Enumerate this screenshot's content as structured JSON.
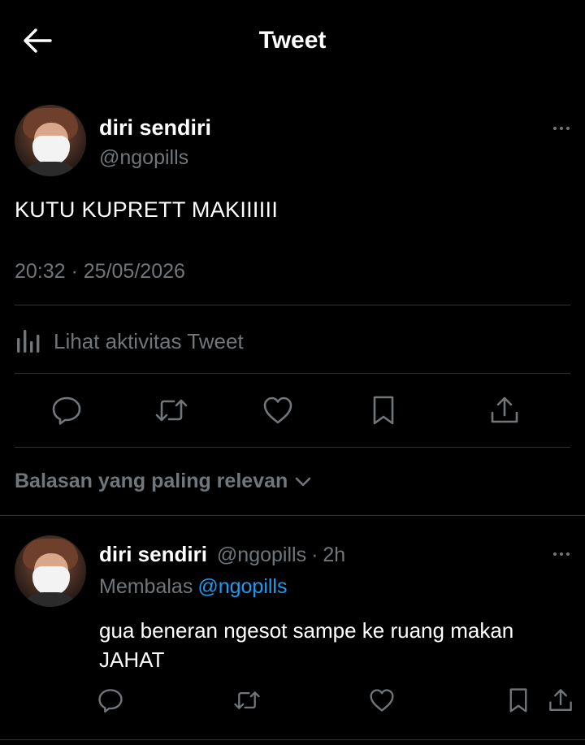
{
  "header": {
    "title": "Tweet",
    "back_icon": "arrow-left-icon"
  },
  "tweet": {
    "display_name": "diri sendiri",
    "handle": "@ngopills",
    "text": "KUTU KUPRETT MAKIIIIII",
    "timestamp": "20:32 · 25/05/2026",
    "activity_label": "Lihat aktivitas Tweet",
    "actions": [
      "reply-icon",
      "retweet-icon",
      "like-icon",
      "bookmark-icon",
      "share-icon"
    ]
  },
  "sort": {
    "label": "Balasan yang paling relevan"
  },
  "reply": {
    "display_name": "diri sendiri",
    "handle": "@ngopills",
    "separator": "·",
    "time": "2h",
    "replying_label": "Membalas",
    "replying_to": "@ngopills",
    "text": "gua beneran ngesot sampe ke ruang makan JAHAT"
  },
  "colors": {
    "background": "#000000",
    "text_primary": "#ffffff",
    "text_secondary": "#71767b",
    "divider": "#2f3336",
    "link": "#1d9bf0"
  }
}
